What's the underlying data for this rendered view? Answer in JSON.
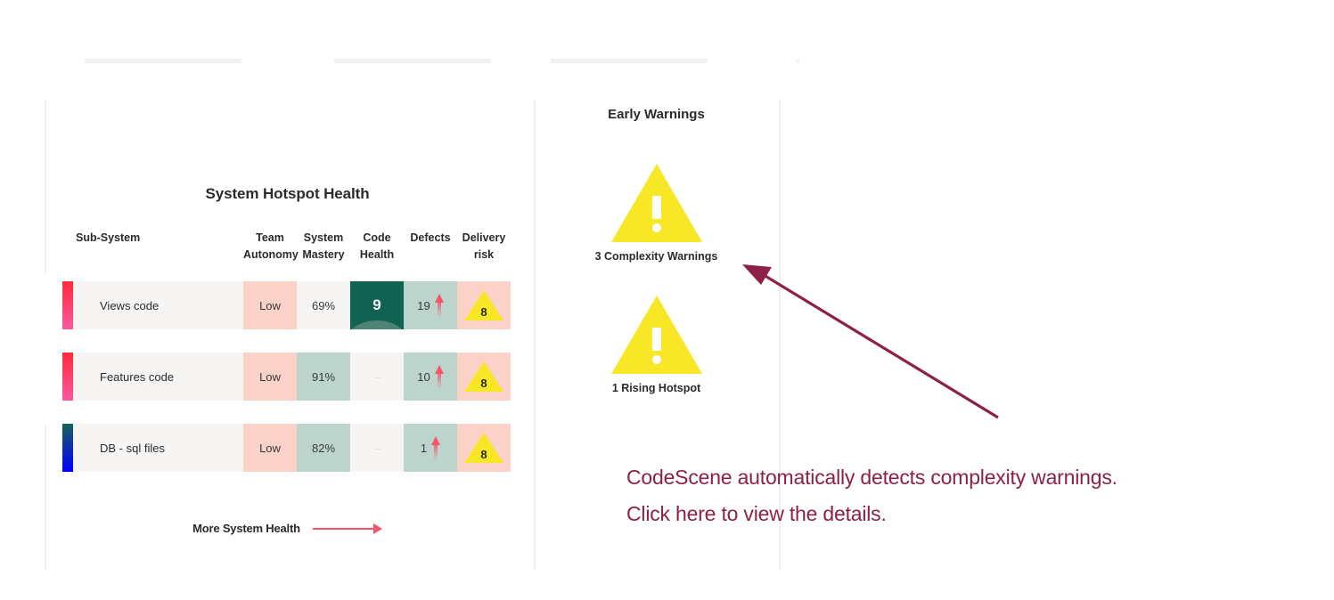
{
  "left_panel": {
    "title": "System Hotspot Health",
    "columns": [
      "Sub-System",
      "Team Autonomy",
      "System Mastery",
      "Code Health",
      "Defects",
      "Delivery risk"
    ],
    "columns_split": [
      {
        "line1": "Team",
        "line2": "Autonomy"
      },
      {
        "line1": "System",
        "line2": "Mastery"
      },
      {
        "line1": "Code",
        "line2": "Health"
      },
      {
        "line1": "Defects",
        "line2": ""
      },
      {
        "line1": "Delivery",
        "line2": "risk"
      }
    ],
    "rows": [
      {
        "name": "Views code",
        "bar_top_color": "#ff2a3c",
        "bar_bottom_color": "#fb5a9e",
        "team_autonomy": "Low",
        "system_mastery": "69%",
        "code_health": "9",
        "code_health_empty": false,
        "defects": "19",
        "defects_trend": "rising-arrow-icon",
        "delivery_risk": "8"
      },
      {
        "name": "Features code",
        "bar_top_color": "#ff2a3c",
        "bar_bottom_color": "#fb5a9e",
        "team_autonomy": "Low",
        "system_mastery": "91%",
        "code_health": "–",
        "code_health_empty": true,
        "defects": "10",
        "defects_trend": "rising-arrow-icon",
        "delivery_risk": "8"
      },
      {
        "name": "DB - sql files",
        "bar_top_color": "#166158",
        "bar_bottom_color": "#0000ff",
        "team_autonomy": "Low",
        "system_mastery": "82%",
        "code_health": "–",
        "code_health_empty": true,
        "defects": "1",
        "defects_trend": "rising-arrow-icon",
        "delivery_risk": "8"
      }
    ],
    "more_link_label": "More System Health"
  },
  "mid_panel": {
    "title": "Early Warnings",
    "warnings": [
      {
        "label": "3 Complexity Warnings",
        "icon": "warning-triangle-icon"
      },
      {
        "label": "1 Rising Hotspot",
        "icon": "warning-triangle-icon"
      }
    ]
  },
  "annotation": {
    "line1": "CodeScene automatically detects complexity warnings.",
    "line2": "Click here to view the details.",
    "color": "#8c2049"
  },
  "palette": {
    "pink_cell": "#fbd2c7",
    "teal_cell": "#bdd4cc",
    "plain_cell": "#f6f5f4",
    "dark_green_cell": "#0f6350",
    "warning_yellow": "#f7e726",
    "link_red": "#f4516b",
    "trend_red": "#f9566b"
  }
}
